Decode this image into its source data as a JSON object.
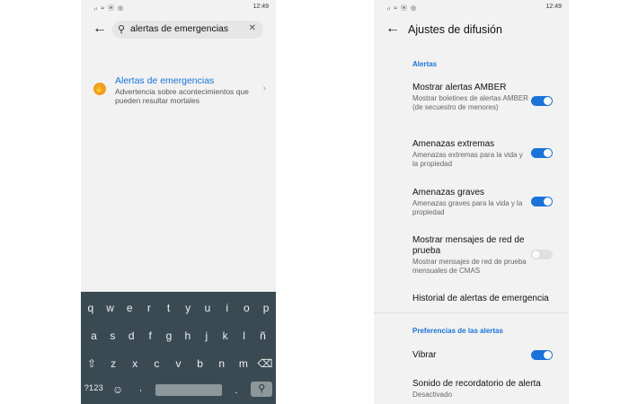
{
  "status_bar": {
    "left_icons": "ᵢₗ ≈ ⓦ ◎",
    "right_icons": "⏰ ∗ ▭ 󠀠",
    "time": "12:49"
  },
  "left": {
    "search": {
      "value": "alertas de emergencias"
    },
    "result": {
      "title": "Alertas de emergencias",
      "description": "Advertencia sobre acontecimientos que pueden resultar mortales"
    },
    "keyboard": {
      "row1": [
        "q",
        "w",
        "e",
        "r",
        "t",
        "y",
        "u",
        "i",
        "o",
        "p"
      ],
      "row1_hints": [
        "1",
        "2",
        "3",
        "4",
        "5",
        "6",
        "7",
        "8",
        "9",
        "0"
      ],
      "row2": [
        "a",
        "s",
        "d",
        "f",
        "g",
        "h",
        "j",
        "k",
        "l",
        "ñ"
      ],
      "row3": [
        "z",
        "x",
        "c",
        "v",
        "b",
        "n",
        "m"
      ],
      "symbols_key": "?123",
      "comma_key": ",",
      "period_key": "."
    }
  },
  "right": {
    "title": "Ajustes de difusión",
    "section_alerts": "Alertas",
    "settings": [
      {
        "title": "Mostrar alertas AMBER",
        "desc": "Mostrar boletines de alertas AMBER (de secuestro de menores)",
        "on": true
      },
      {
        "title": "Amenazas extremas",
        "desc": "Amenazas extremas para la vida y la propiedad",
        "on": true
      },
      {
        "title": "Amenazas graves",
        "desc": "Amenazas graves para la vida y la propiedad",
        "on": true
      },
      {
        "title": "Mostrar mensajes de red de prueba",
        "desc": "Mostrar mensajes de red de prueba mensuales de CMAS",
        "on": false
      }
    ],
    "history": "Historial de alertas de emergencia",
    "section_prefs": "Preferencias de las alertas",
    "vibrate": {
      "title": "Vibrar",
      "on": true
    },
    "reminder": {
      "title": "Sonido de recordatorio de alerta",
      "value": "Desactivado"
    }
  },
  "colors": {
    "accent": "#1a73d9",
    "keyboard_bg": "#3a4a52",
    "result_icon": "#f29b22"
  }
}
